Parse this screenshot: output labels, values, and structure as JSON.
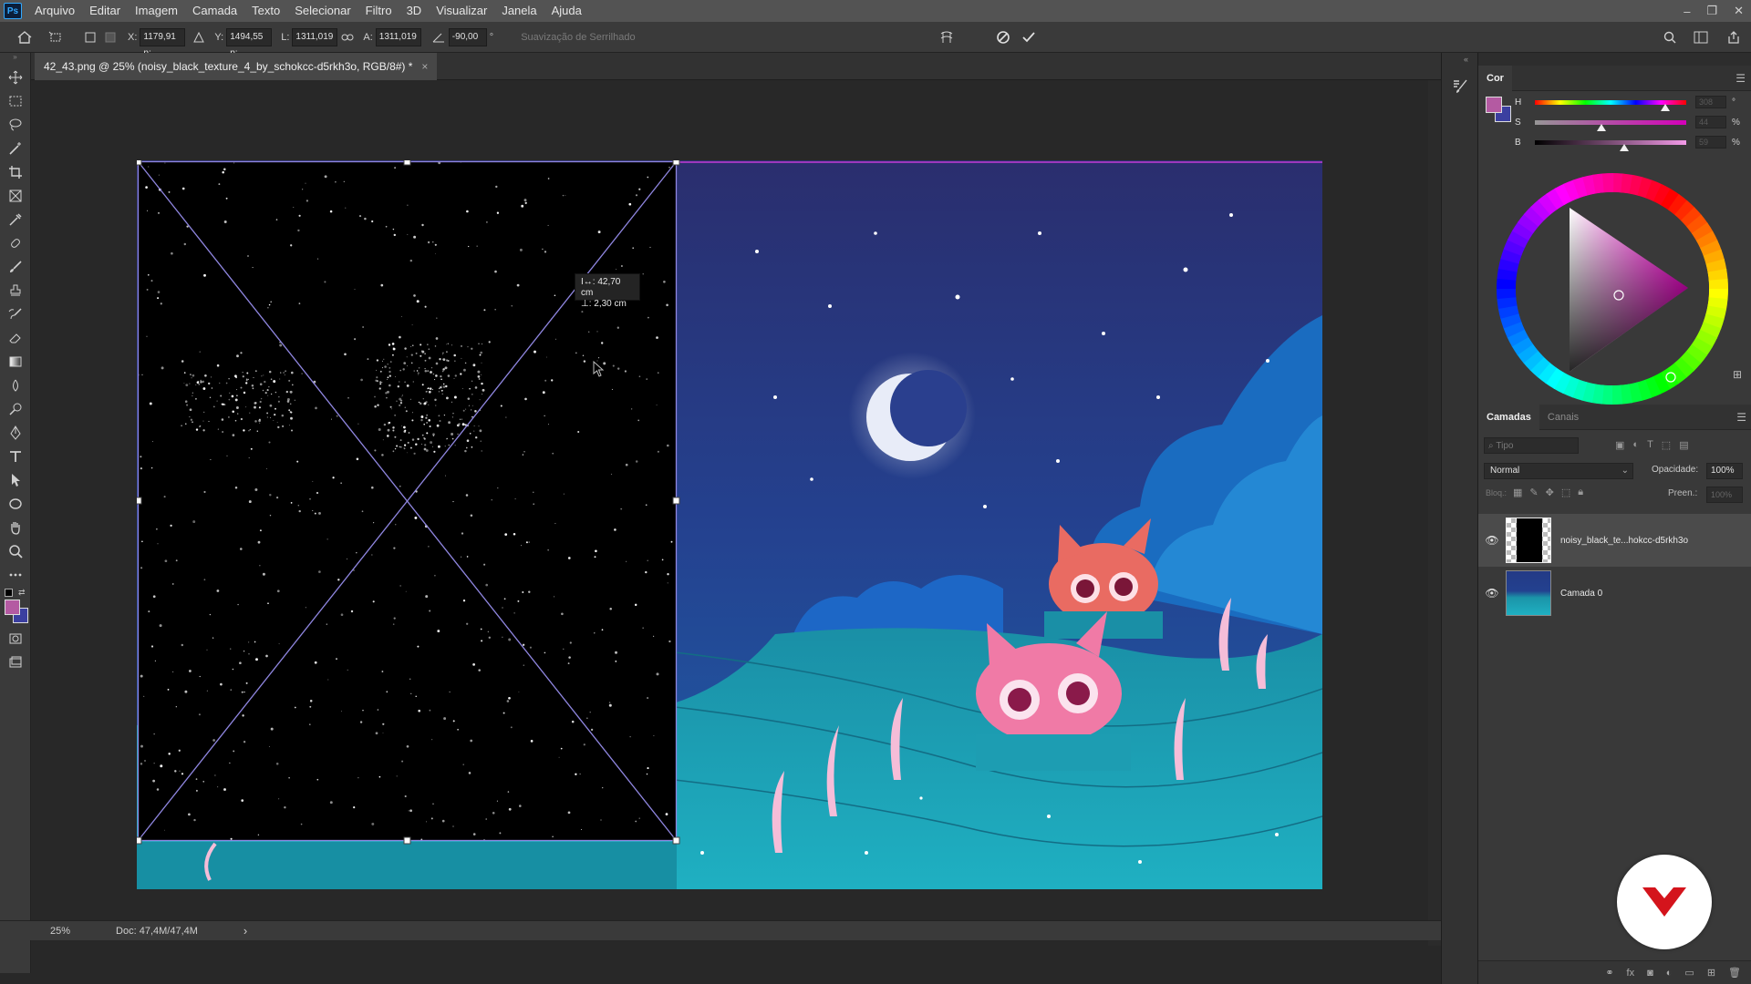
{
  "app_logo": "Ps",
  "menu": [
    "Arquivo",
    "Editar",
    "Imagem",
    "Camada",
    "Texto",
    "Selecionar",
    "Filtro",
    "3D",
    "Visualizar",
    "Janela",
    "Ajuda"
  ],
  "window_controls": {
    "minimize": "–",
    "restore": "❐",
    "close": "✕"
  },
  "options_bar": {
    "x_label": "X:",
    "x_value": "1179,91 p:",
    "y_label": "Y:",
    "y_value": "1494,55 p:",
    "w_label": "L:",
    "w_value": "1311,019",
    "h_label": "A:",
    "h_value": "1311,019",
    "angle_value": "-90,00",
    "angle_unit": "°",
    "smoothing_label": "Suavização de Serrilhado"
  },
  "document": {
    "tab_title": "42_43.png @ 25% (noisy_black_texture_4_by_schokcc-d5rkh3o, RGB/8#) *",
    "close_glyph": "×",
    "measure_w": "42,70 cm",
    "measure_h": "2,30 cm"
  },
  "status": {
    "zoom": "25%",
    "doc_info": "Doc: 47,4M/47,4M",
    "arrow": "›"
  },
  "color_panel": {
    "tab": "Cor",
    "h_label": "H",
    "h_value": "308",
    "h_unit": "°",
    "s_label": "S",
    "s_value": "44",
    "s_unit": "%",
    "b_label": "B",
    "b_value": "59",
    "b_unit": "%",
    "fg_color": "#b45aa2",
    "bg_color": "#3b3fa0",
    "hue_level": 0.86,
    "sat_level": 0.44,
    "bri_level": 0.59
  },
  "layers_panel": {
    "tabs": [
      "Camadas",
      "Canais"
    ],
    "filter_placeholder": "Tipo",
    "blend_mode": "Normal",
    "opacity_label": "Opacidade:",
    "opacity_value": "100%",
    "lock_label": "Bloq.:",
    "fill_label": "Preen.:",
    "fill_value": "100%",
    "layers": [
      {
        "name": "noisy_black_te...hokcc-d5rkh3o"
      },
      {
        "name": "Camada 0"
      }
    ]
  }
}
